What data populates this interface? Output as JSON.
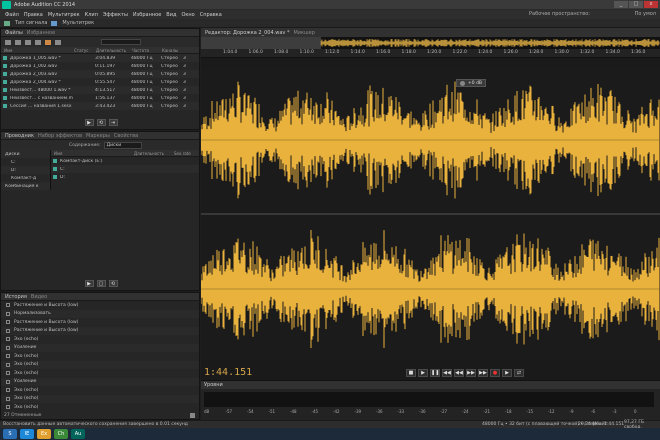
{
  "window": {
    "title": "Adobe Audition CC 2014",
    "controls": [
      "_",
      "□",
      "x"
    ]
  },
  "menu": [
    "Файл",
    "Правка",
    "Мультитрек",
    "Клип",
    "Эффекты",
    "Избранное",
    "Вид",
    "Окно",
    "Справка"
  ],
  "workspace": {
    "label": "Рабочее пространство:",
    "value": "По умол"
  },
  "toolbar": {
    "mode1": "Тип сигнала",
    "mode2": "Мультитрек"
  },
  "files_panel": {
    "tabs": [
      "Файлы",
      "Избранное"
    ],
    "columns": [
      "Имя",
      "Статус",
      "Длительность",
      "Частота",
      "Каналы"
    ],
    "rows": [
      {
        "name": "Дорожка 1_005.wav *",
        "dur": "3:04.839",
        "rate": "48000 Гц",
        "ch": "Стерео",
        "n": "3"
      },
      {
        "name": "Дорожка 1_002.wav",
        "dur": "0:11.197",
        "rate": "48000 Гц",
        "ch": "Стерео",
        "n": "3"
      },
      {
        "name": "Дорожка 2_003.wav",
        "dur": "0:05.895",
        "rate": "48000 Гц",
        "ch": "Стерео",
        "n": "3"
      },
      {
        "name": "Дорожка 2_004.wav *",
        "dur": "0:55.547",
        "rate": "48000 Гц",
        "ch": "Стерео",
        "n": "3"
      },
      {
        "name": "Неизвест... 48000 1.wav *",
        "dur": "4:13.517",
        "rate": "48000 Гц",
        "ch": "Стерео",
        "n": "3"
      },
      {
        "name": "Неизвест... с названием.mp3",
        "dur": "1:56.137",
        "rate": "48000 Гц",
        "ch": "Стерео",
        "n": "3"
      },
      {
        "name": "Сессия ... названия 1.sesx *",
        "dur": "3:43.423",
        "rate": "48000 Гц",
        "ch": "Стерео",
        "n": "3"
      }
    ]
  },
  "browser_panel": {
    "tabs": [
      "Проводник",
      "Набор эффектов",
      "Маркеры",
      "Свойства"
    ],
    "content_label": "Содержание:",
    "content_value": "Диски",
    "tree": [
      "Диски",
      "C:",
      "D:",
      "Компакт-д",
      "Комбинация к"
    ],
    "columns": [
      "Имя",
      "Длительность",
      "Sex.rate"
    ],
    "items": [
      "Компакт-диск (E:)",
      "C:",
      "D:"
    ]
  },
  "history_panel": {
    "tabs": [
      "История",
      "Видео"
    ],
    "items": [
      "Растяжение и Высота (low)",
      "Нормализовать",
      "Растяжение и Высота (low)",
      "Растяжение и Высота (low)",
      "Эхо (echo)",
      "Усиление",
      "Эхо (echo)",
      "Эхо (echo)",
      "Эхо (echo)",
      "Усиление",
      "Эхо (echo)",
      "Эхо (echo)",
      "Эхо (echo)"
    ],
    "footer": "27 Отмененные"
  },
  "editor": {
    "tabs": [
      "Редактор: Дорожка 2_004.wav *",
      "Микшер"
    ],
    "ruler": [
      "1:04.0",
      "1:06.0",
      "1:08.0",
      "1:10.0",
      "1:12.0",
      "1:14.0",
      "1:16.0",
      "1:18.0",
      "1:20.0",
      "1:22.0",
      "1:24.0",
      "1:26.0",
      "1:28.0",
      "1:30.0",
      "1:32.0",
      "1:34.0",
      "1:36.0"
    ],
    "zoom_readout": "+0 dB",
    "timecode": "1:44.151",
    "transport": [
      "■",
      "▶",
      "❚❚",
      "◀◀",
      "▶▶",
      "◀◀",
      "▶▶",
      "●",
      "▶",
      "⇄"
    ],
    "waveform_color": "#e8b23c"
  },
  "levels": {
    "title": "Уровни",
    "scale": [
      "dB",
      "-57",
      "-54",
      "-51",
      "-48",
      "-45",
      "-42",
      "-39",
      "-36",
      "-33",
      "-30",
      "-27",
      "-24",
      "-21",
      "-18",
      "-15",
      "-12",
      "-9",
      "-6",
      "-3",
      "0"
    ]
  },
  "status": {
    "left": "Восстановить данные автоматического сохранения завершено в 0.01 секунд",
    "right1": "48000 Гц • 32 бит (с плавающей точкой) • Стерео",
    "right2": "20,34 Мбайт",
    "right3": "1:44.151",
    "right4": "97,27 ГБ свобод."
  },
  "taskbar": {
    "apps": [
      "S",
      "IE",
      "Ex",
      "Ch",
      "Au"
    ]
  }
}
